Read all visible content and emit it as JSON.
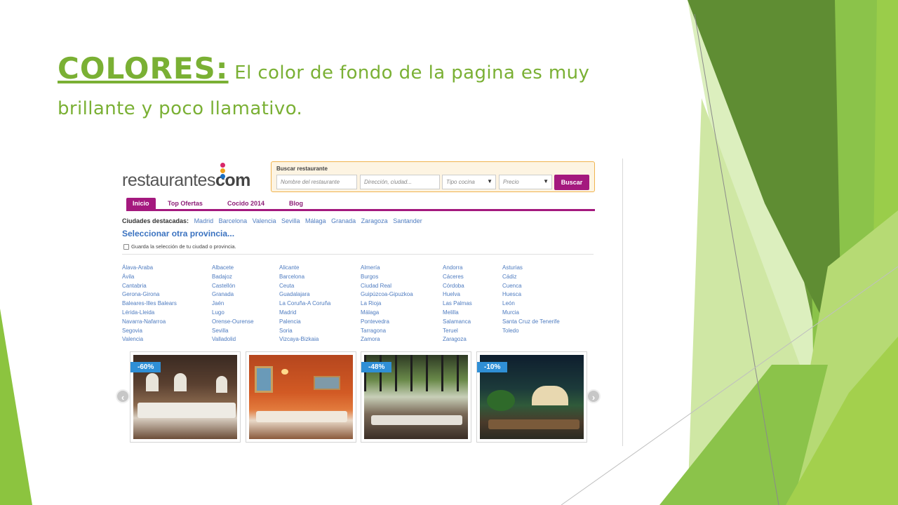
{
  "slide": {
    "title_head": "COLORES:",
    "title_body": " El color de fondo de la pagina es muy brillante y poco llamativo."
  },
  "site": {
    "logo_text": "restaurantes",
    "logo_com": "com",
    "search": {
      "label": "Buscar restaurante",
      "name_placeholder": "Nombre del restaurante",
      "address_placeholder": "Dirección, ciudad...",
      "cuisine_value": "Tipo cocina",
      "price_value": "Precio",
      "button": "Buscar"
    },
    "nav": [
      "Inicio",
      "Top Ofertas",
      "Cocido 2014",
      "Blog"
    ],
    "featured_label": "Ciudades destacadas:",
    "featured_cities": [
      "Madrid",
      "Barcelona",
      "Valencia",
      "Sevilla",
      "Málaga",
      "Granada",
      "Zaragoza",
      "Santander"
    ],
    "select_province": "Seleccionar otra provincia...",
    "remember_label": "Guarda la selección de tu ciudad o provincia.",
    "provinces": [
      [
        "Álava-Araba",
        "Ávila",
        "Cantabria",
        "Gerona-Girona",
        "Baleares-Illes Balears",
        "Lérida-Lleida",
        "Navarra-Nafarroa",
        "Segovia",
        "Valencia"
      ],
      [
        "Albacete",
        "Badajoz",
        "Castellón",
        "Granada",
        "Jaén",
        "Lugo",
        "Orense-Ourense",
        "Sevilla",
        "Valladolid"
      ],
      [
        "Alicante",
        "Barcelona",
        "Ceuta",
        "Guadalajara",
        "La Coruña-A Coruña",
        "Madrid",
        "Palencia",
        "Soria",
        "Vizcaya-Bizkaia"
      ],
      [
        "Almería",
        "Burgos",
        "Ciudad Real",
        "Guipúzcoa-Gipuzkoa",
        "La Rioja",
        "Málaga",
        "Pontevedra",
        "Tarragona",
        "Zamora"
      ],
      [
        "Andorra",
        "Cáceres",
        "Córdoba",
        "Huelva",
        "Las Palmas",
        "Melilla",
        "Salamanca",
        "Teruel",
        "Zaragoza"
      ],
      [
        "Asturias",
        "Cádiz",
        "Cuenca",
        "Huesca",
        "León",
        "Murcia",
        "Santa Cruz de Tenerife",
        "Toledo"
      ]
    ],
    "deals": [
      {
        "badge": "-60%"
      },
      {
        "badge": ""
      },
      {
        "badge": "-48%"
      },
      {
        "badge": "-10%"
      }
    ],
    "icons": {
      "prev": "chevron-left-icon",
      "next": "chevron-right-icon"
    },
    "colors": {
      "accent": "#a4197e",
      "link": "#4f7cc0",
      "slide_green": "#7ab034",
      "badge": "#2f8fd6"
    }
  }
}
